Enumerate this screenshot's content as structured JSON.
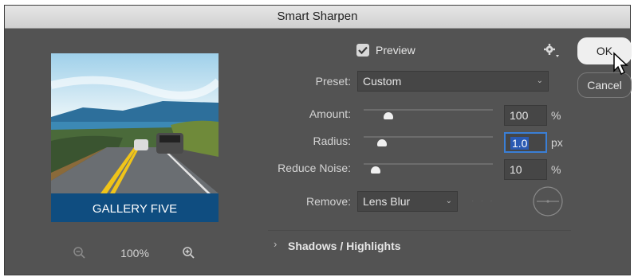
{
  "window": {
    "title": "Smart Sharpen"
  },
  "preview_image": {
    "caption": "GALLERY FIVE"
  },
  "zoom": {
    "level": "100%"
  },
  "preview": {
    "label": "Preview",
    "checked": true
  },
  "preset": {
    "label": "Preset:",
    "value": "Custom"
  },
  "amount": {
    "label": "Amount:",
    "value": "100",
    "unit": "%",
    "slider_fraction": 0.19
  },
  "radius": {
    "label": "Radius:",
    "value": "1.0",
    "unit": "px",
    "slider_fraction": 0.14
  },
  "reduce_noise": {
    "label": "Reduce Noise:",
    "value": "10",
    "unit": "%",
    "slider_fraction": 0.09
  },
  "remove": {
    "label": "Remove:",
    "value": "Lens Blur"
  },
  "shadows_highlights": {
    "label": "Shadows / Highlights"
  },
  "buttons": {
    "ok": "OK",
    "cancel": "Cancel"
  },
  "colors": {
    "dialog_bg": "#535353",
    "field_bg": "#464646",
    "selected_field": "#2a5ab3",
    "text": "#d4d4d4"
  }
}
